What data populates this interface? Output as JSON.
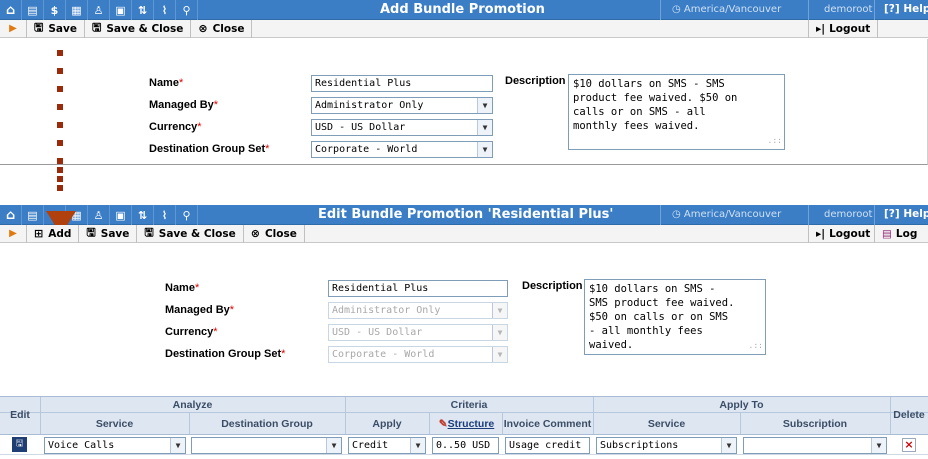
{
  "header1": {
    "nav_icons": [
      "home-icon",
      "list-icon",
      "dollar-icon",
      "grid-icon",
      "person-icon",
      "customers-icon",
      "transfer-icon",
      "chart-icon",
      "search-icon"
    ],
    "title": "Add Bundle Promotion",
    "timezone": "America/Vancouver",
    "user": "demoroot",
    "help": "Help",
    "help_glyph": "?"
  },
  "toolbar1": {
    "save": "Save",
    "save_close": "Save & Close",
    "close": "Close",
    "logout": "Logout"
  },
  "form1": {
    "name_label": "Name",
    "managed_by_label": "Managed By",
    "currency_label": "Currency",
    "dgs_label": "Destination Group Set",
    "description_label": "Description",
    "name_value": "Residential Plus",
    "managed_by_value": "Administrator Only",
    "currency_value": "USD - US Dollar",
    "dgs_value": "Corporate - World",
    "description_value": "$10 dollars on SMS - SMS\nproduct fee waived. $50 on\ncalls or on SMS - all\nmonthly fees waived."
  },
  "header2": {
    "title": "Edit Bundle Promotion 'Residential Plus'",
    "timezone": "America/Vancouver",
    "user": "demoroot",
    "help": "Help"
  },
  "toolbar2": {
    "add": "Add",
    "save": "Save",
    "save_close": "Save & Close",
    "close": "Close",
    "logout": "Logout",
    "log": "Log"
  },
  "form2": {
    "name_label": "Name",
    "managed_by_label": "Managed By",
    "currency_label": "Currency",
    "dgs_label": "Destination Group Set",
    "description_label": "Description",
    "name_value": "Residential Plus",
    "managed_by_value": "Administrator Only",
    "currency_value": "USD - US Dollar",
    "dgs_value": "Corporate - World",
    "description_value": "$10 dollars on SMS -\nSMS product fee waived.\n$50 on calls or on SMS\n- all monthly fees\nwaived."
  },
  "grid": {
    "edit_header": "Edit",
    "delete_header": "Delete",
    "groups": {
      "analyze": "Analyze",
      "criteria": "Criteria",
      "apply_to": "Apply To"
    },
    "columns": {
      "service": "Service",
      "destination_group": "Destination Group",
      "apply": "Apply",
      "structure": "Structure",
      "invoice_comment": "Invoice Comment",
      "apply_service": "Service",
      "subscription": "Subscription"
    },
    "row": {
      "service": "Voice Calls",
      "destination_group": "",
      "apply": "Credit",
      "structure": "0..50 USD -",
      "invoice_comment": "Usage credit",
      "apply_service": "Subscriptions",
      "subscription": ""
    }
  },
  "colors": {
    "header_blue": "#3b7ec6",
    "arrow_brown": "#b1400f",
    "delete_red": "#d00000"
  }
}
